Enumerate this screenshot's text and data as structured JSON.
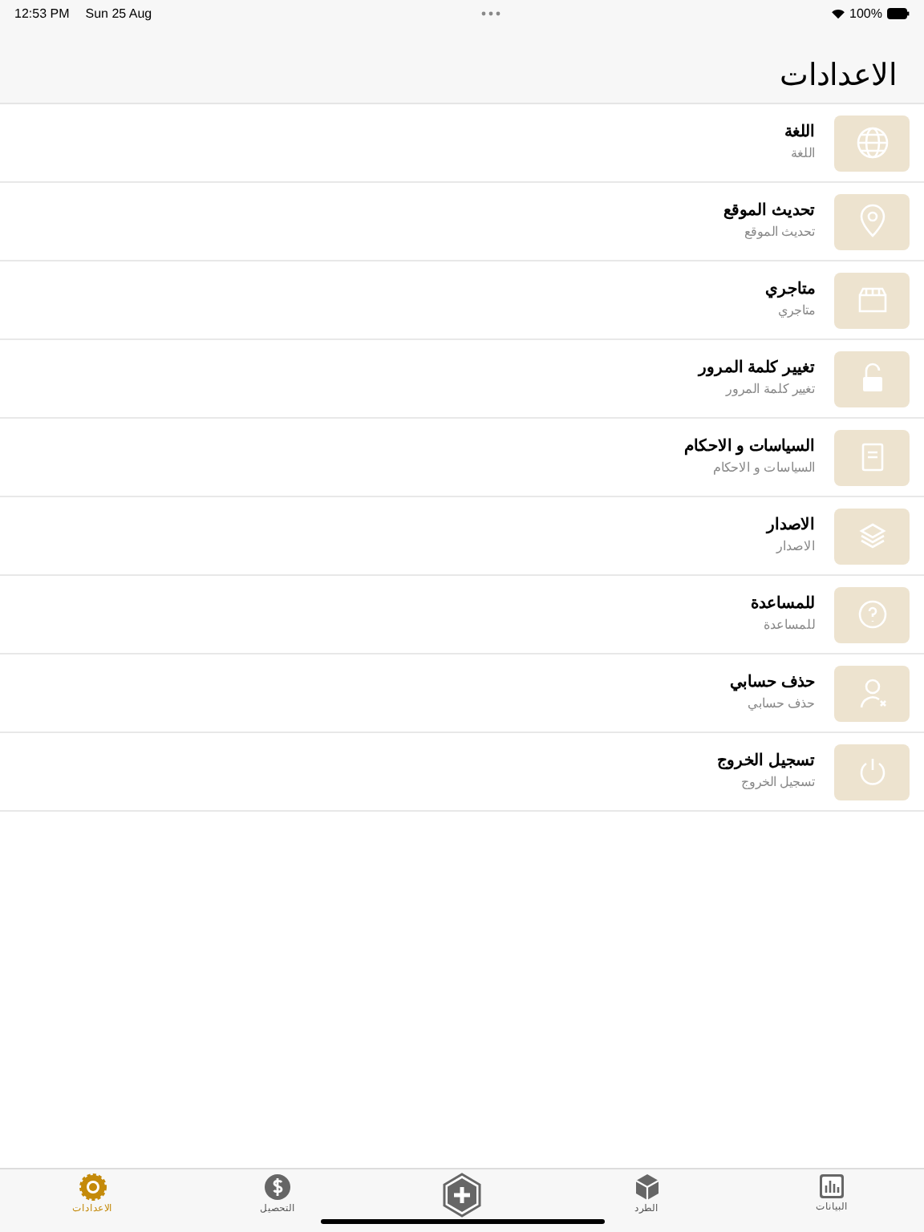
{
  "status_bar": {
    "time": "12:53 PM",
    "date": "Sun 25 Aug",
    "battery": "100%"
  },
  "title": "الاعدادات",
  "items": [
    {
      "title": "اللغة",
      "subtitle": "اللغة"
    },
    {
      "title": "تحديث الموقع",
      "subtitle": "تحديث الموقع"
    },
    {
      "title": "متاجري",
      "subtitle": "متاجري"
    },
    {
      "title": "تغيير كلمة المرور",
      "subtitle": "تغيير كلمة المرور"
    },
    {
      "title": "السياسات و الاحكام",
      "subtitle": "السياسات و الاحكام"
    },
    {
      "title": "الاصدار",
      "subtitle": "الاصدار"
    },
    {
      "title": "للمساعدة",
      "subtitle": "للمساعدة"
    },
    {
      "title": "حذف حسابي",
      "subtitle": "حذف حسابي"
    },
    {
      "title": "تسجيل الخروج",
      "subtitle": "تسجيل الخروج"
    }
  ],
  "tabs": [
    {
      "kind": "stats",
      "label": "البيانات",
      "selected": false
    },
    {
      "kind": "parcel",
      "label": "الطرد",
      "selected": false
    },
    {
      "kind": "add",
      "selected": false
    },
    {
      "kind": "collection",
      "label": "التحصيل",
      "selected": false
    },
    {
      "kind": "settings",
      "label": "الاعدادات",
      "selected": true
    }
  ]
}
